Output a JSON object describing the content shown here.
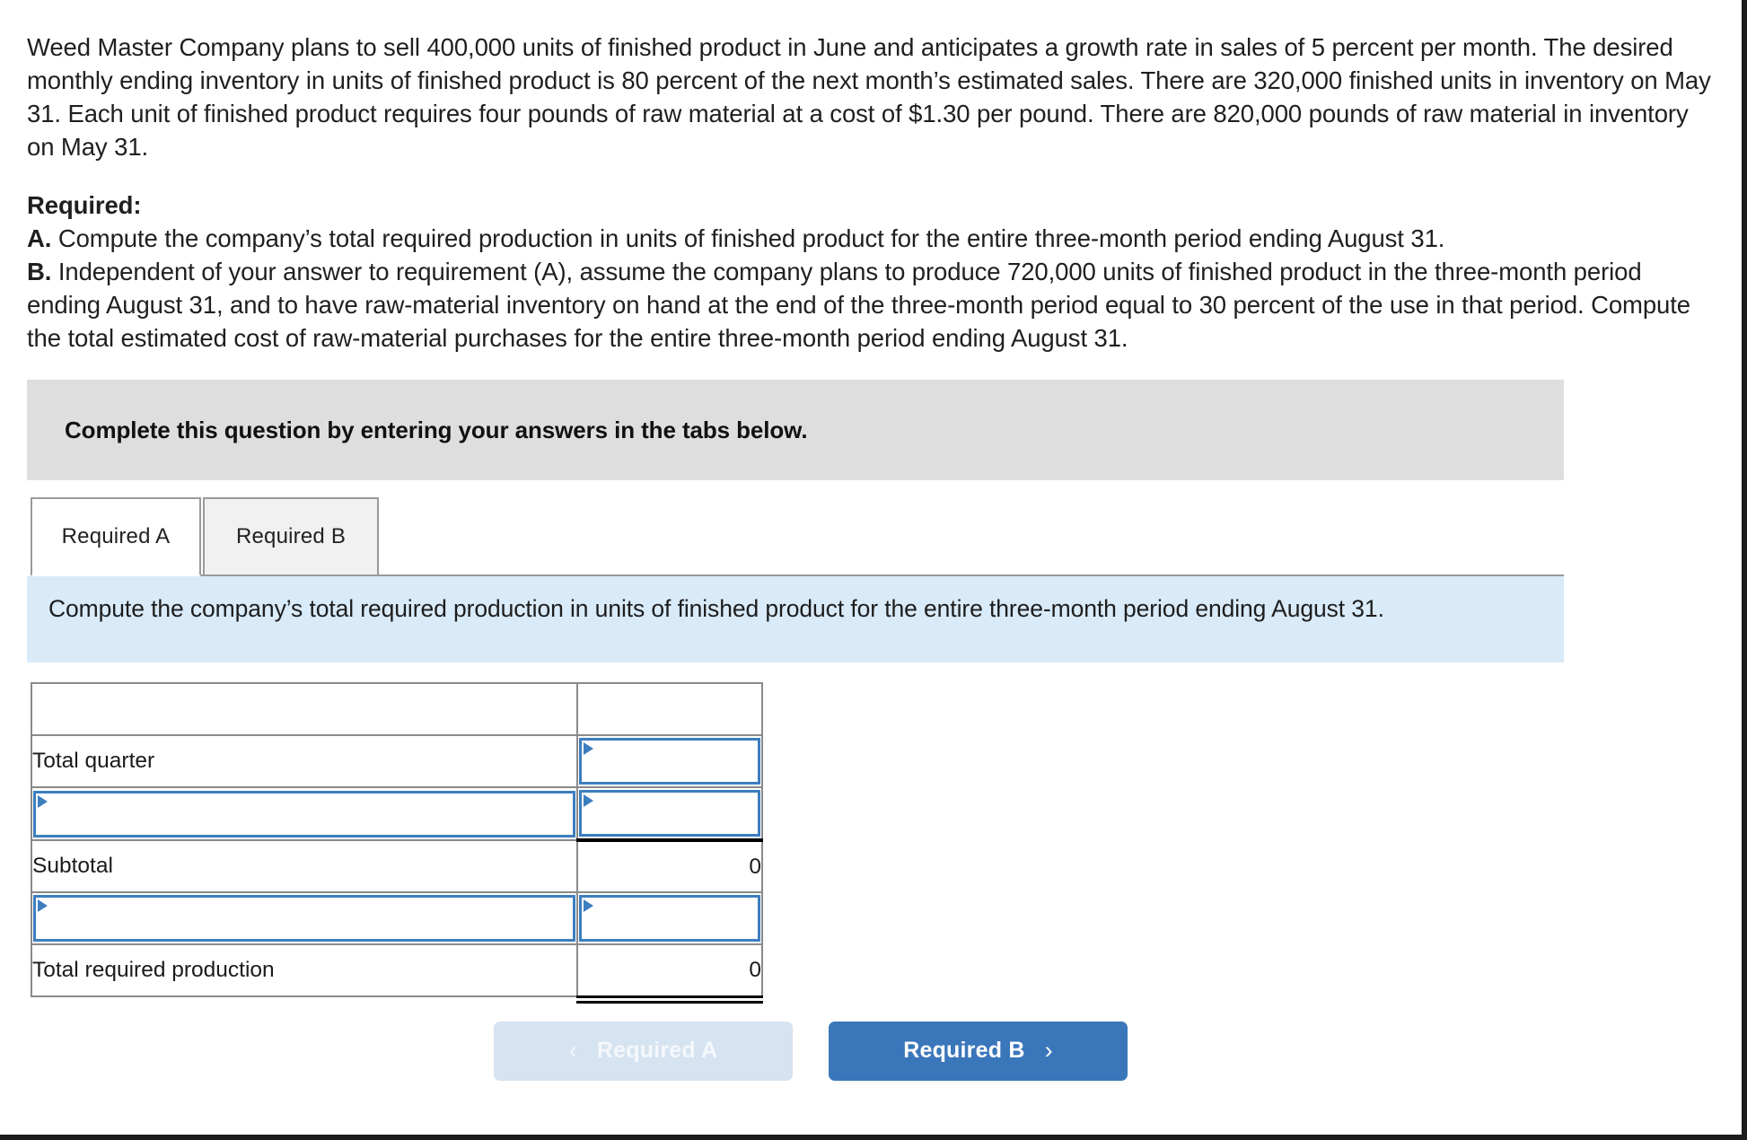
{
  "problem": {
    "paragraph": "Weed Master Company plans to sell 400,000 units of finished product in June and anticipates a growth rate in sales of 5 percent per month. The desired monthly ending inventory in units of finished product is 80 percent of the next month’s estimated sales. There are 320,000 finished units in inventory on May 31. Each unit of finished product requires four pounds of raw material at a cost of $1.30 per pound. There are 820,000 pounds of raw material in inventory on May 31.",
    "required_heading": "Required:",
    "items": [
      {
        "letter": "A.",
        "text": " Compute the company’s total required production in units of finished product for the entire three-month period ending August 31."
      },
      {
        "letter": "B.",
        "text": " Independent of your answer to requirement (A), assume the company plans to produce 720,000 units of finished product in the three-month period ending August 31, and to have raw-material inventory on hand at the end of the three-month period equal to 30 percent of the use in that period. Compute the total estimated cost of raw-material purchases for the entire three-month period ending August 31."
      }
    ]
  },
  "banner": {
    "complete_text": "Complete this question by entering your answers in the tabs below."
  },
  "tabs": [
    {
      "id": "required-a",
      "label": "Required A",
      "active": true
    },
    {
      "id": "required-b",
      "label": "Required B",
      "active": false
    }
  ],
  "instruction": {
    "text": "Compute the company’s total required production in units of finished product for the entire three-month period ending August 31."
  },
  "table": {
    "header_label": "",
    "rows": [
      {
        "type": "label-input",
        "label": "Total quarter",
        "value": "",
        "value_editable": true,
        "value_style": "plain"
      },
      {
        "type": "input-input",
        "label": "",
        "value": "",
        "label_editable": true,
        "value_editable": true,
        "value_style": "plain"
      },
      {
        "type": "label-value",
        "label": "Subtotal",
        "value": "0",
        "value_editable": false,
        "value_style": "topline"
      },
      {
        "type": "input-input",
        "label": "",
        "value": "",
        "label_editable": true,
        "value_editable": true,
        "value_style": "plain"
      },
      {
        "type": "label-value",
        "label": "Total required production",
        "value": "0",
        "value_editable": false,
        "value_style": "dblbottom"
      }
    ]
  },
  "nav": {
    "prev_label": "Required A",
    "prev_icon": "chevron-left-icon",
    "prev_glyph": "‹",
    "prev_disabled": true,
    "next_label": "Required B",
    "next_icon": "chevron-right-icon",
    "next_glyph": "›",
    "next_disabled": false
  },
  "colors": {
    "gray_banner": "#dedede",
    "blue_banner": "#d9eaf8",
    "table_header": "#7aafea",
    "input_border": "#3d7ebf",
    "next_button": "#3a76ba",
    "prev_button": "#d6e3f0"
  }
}
